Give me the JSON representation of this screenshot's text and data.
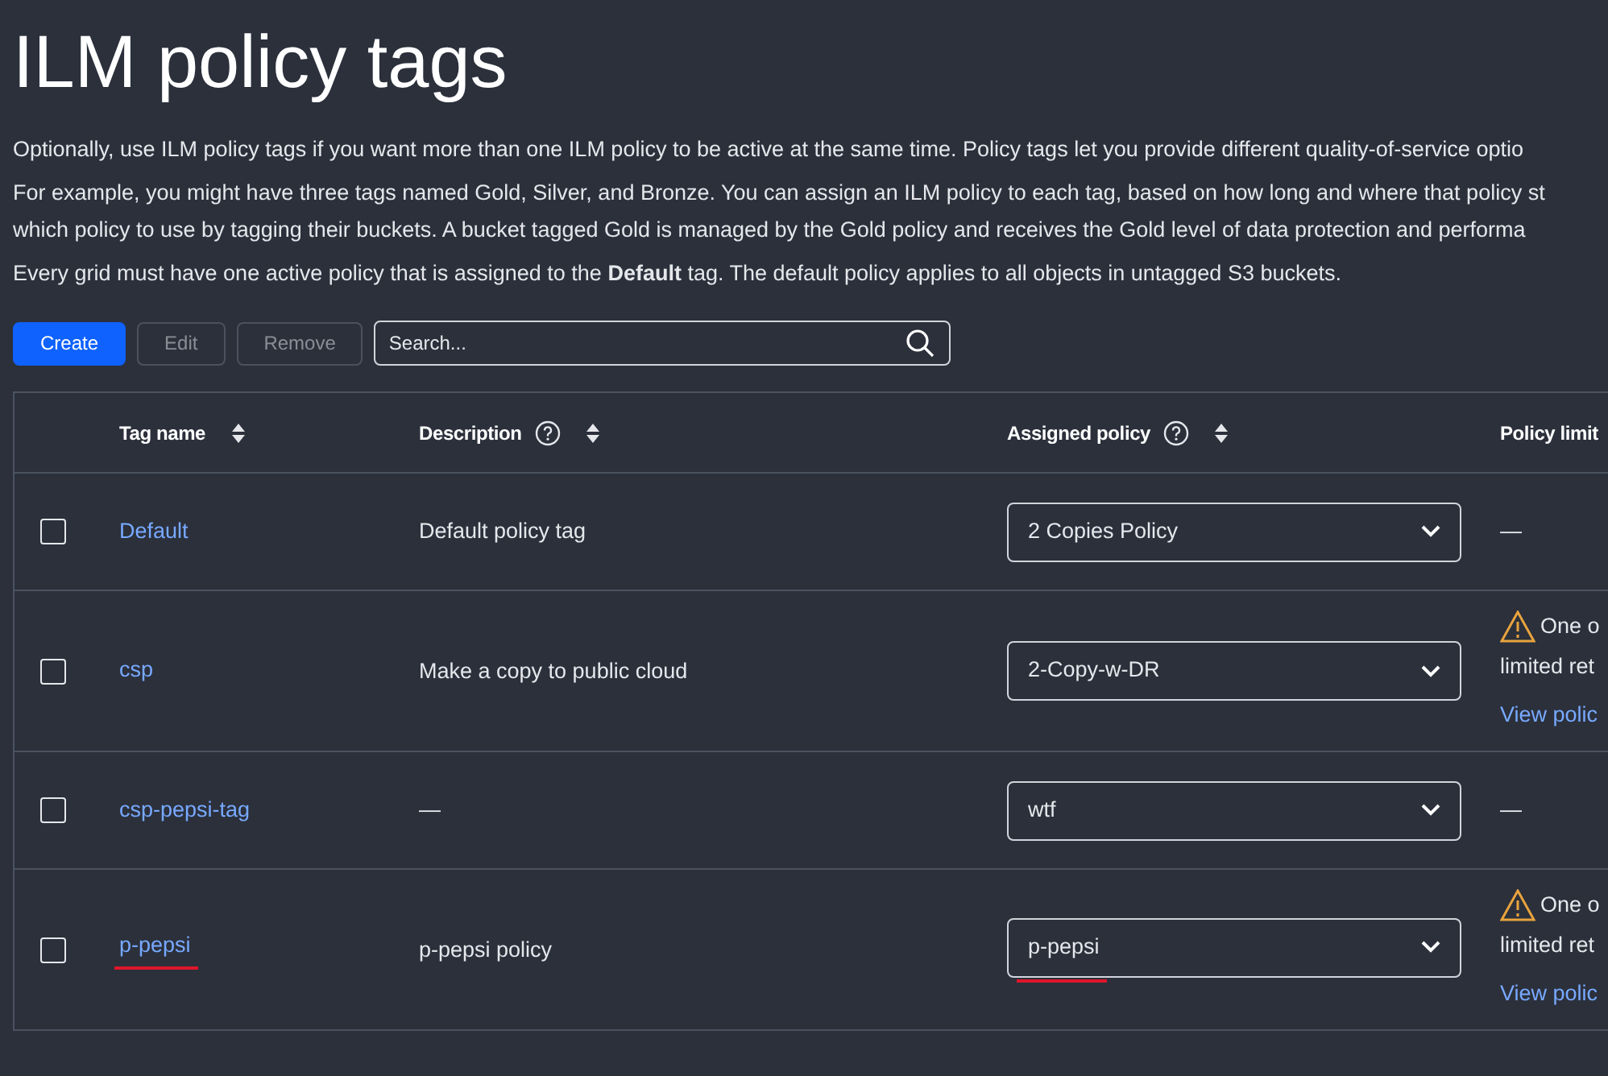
{
  "title": "ILM policy tags",
  "intro": [
    {
      "lines": [
        "Optionally, use ILM policy tags if you want more than one ILM policy to be active at the same time. Policy tags let you provide different quality-of-service optio"
      ]
    },
    {
      "lines": [
        "For example, you might have three tags named Gold, Silver, and Bronze. You can assign an ILM policy to each tag, based on how long and where that policy st",
        "which policy to use by tagging their buckets. A bucket tagged Gold is managed by the Gold policy and receives the Gold level of data protection and performa"
      ]
    },
    {
      "lines": [
        "Every grid must have one active policy that is assigned to the **Default** tag. The default policy applies to all objects in untagged S3 buckets."
      ]
    }
  ],
  "toolbar": {
    "buttons": [
      {
        "label": "Create",
        "disabled": false,
        "kind": "primary"
      },
      {
        "label": "Edit",
        "disabled": true,
        "kind": "secondary"
      },
      {
        "label": "Remove",
        "disabled": true,
        "kind": "secondary"
      }
    ],
    "search": {
      "placeholder": "Search..."
    }
  },
  "table": {
    "columns": [
      {
        "label": "Tag name",
        "help": false,
        "sortable": true
      },
      {
        "label": "Description",
        "help": true,
        "sortable": true
      },
      {
        "label": "Assigned policy",
        "help": true,
        "sortable": true
      },
      {
        "label": "Policy limit"
      }
    ],
    "rows": [
      {
        "checked": false,
        "tag": "Default",
        "description": "Default policy tag",
        "policy": "2 Copies Policy",
        "marked": false,
        "limit": {
          "kind": "none",
          "text": "—"
        }
      },
      {
        "checked": false,
        "tag": "csp",
        "description": "Make a copy to public cloud",
        "policy": "2-Copy-w-DR",
        "marked": false,
        "limit": {
          "kind": "warning",
          "lines": [
            "One o",
            "limited ret"
          ],
          "link": "View polic"
        }
      },
      {
        "checked": false,
        "tag": "csp-pepsi-tag",
        "description": "—",
        "policy": "wtf",
        "marked": false,
        "limit": {
          "kind": "none",
          "text": "—"
        }
      },
      {
        "checked": false,
        "tag": "p-pepsi",
        "description": "p-pepsi policy",
        "policy": "p-pepsi",
        "marked": true,
        "limit": {
          "kind": "warning",
          "lines": [
            "One o",
            "limited ret"
          ],
          "link": "View polic"
        }
      }
    ]
  }
}
